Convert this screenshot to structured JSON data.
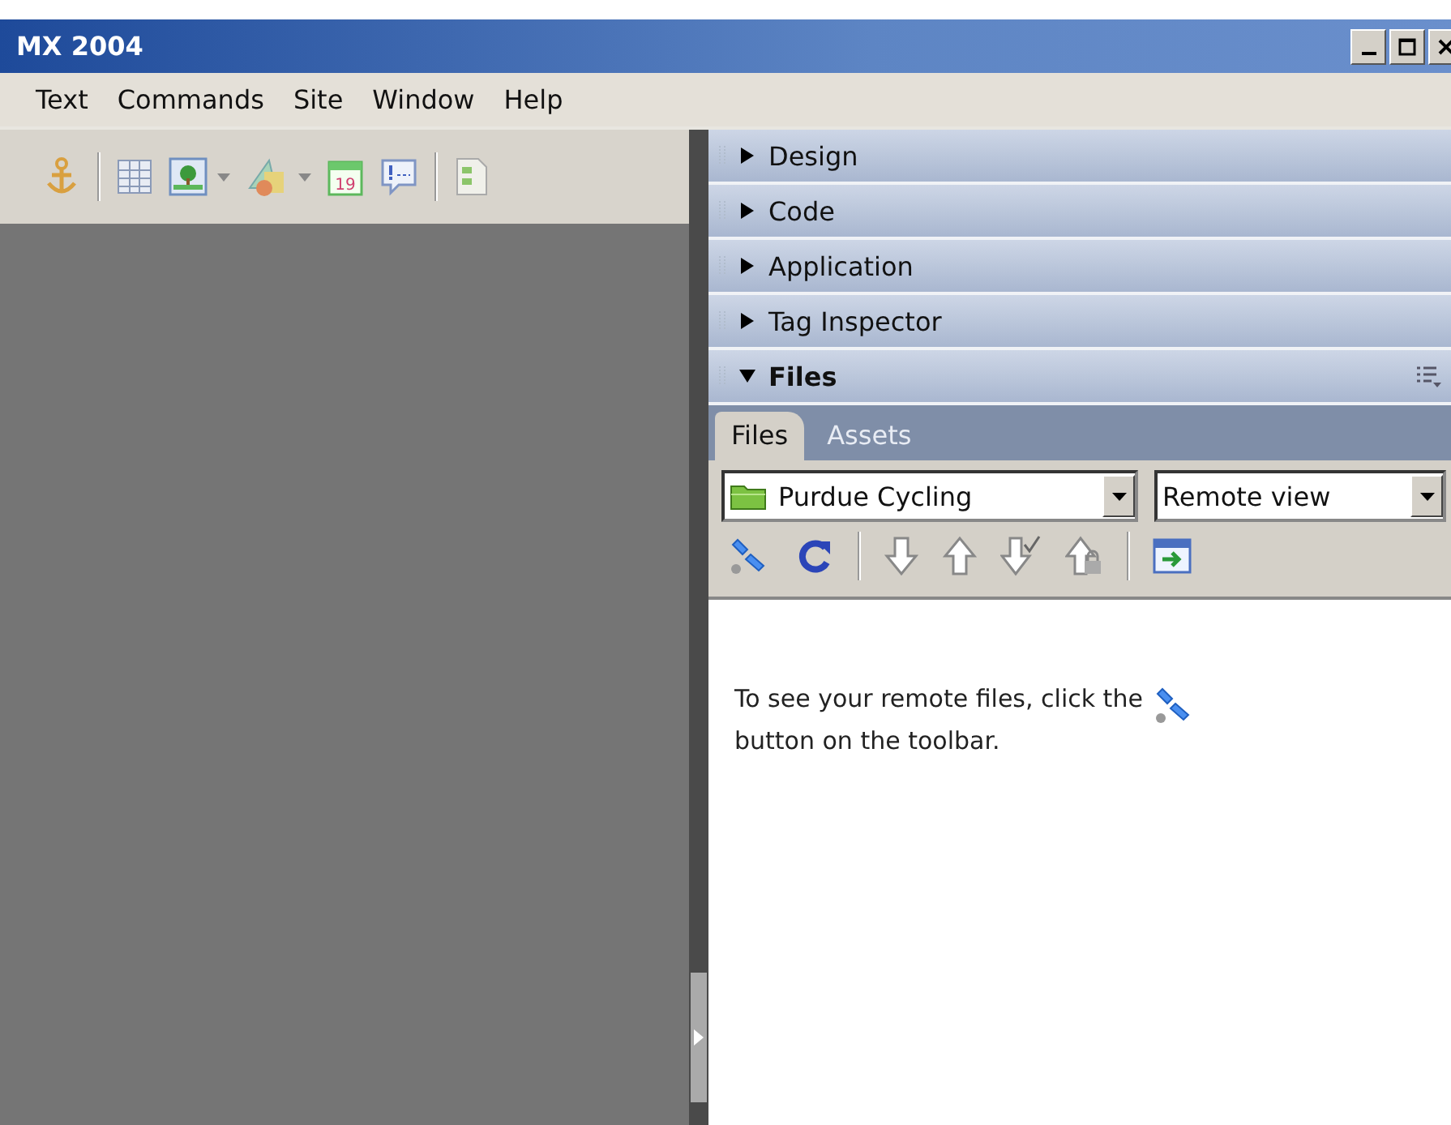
{
  "window": {
    "title": "MX 2004"
  },
  "toolbar": {
    "calendar_day": "19"
  },
  "menu": [
    "Text",
    "Commands",
    "Site",
    "Window",
    "Help"
  ],
  "panels": [
    {
      "label": "Design",
      "expanded": false
    },
    {
      "label": "Code",
      "expanded": false
    },
    {
      "label": "Application",
      "expanded": false
    },
    {
      "label": "Tag Inspector",
      "expanded": false
    },
    {
      "label": "Files",
      "expanded": true
    }
  ],
  "tabs": [
    {
      "label": "Files",
      "selected": true
    },
    {
      "label": "Assets",
      "selected": false
    }
  ],
  "site_dropdown": {
    "value": "Purdue Cycling"
  },
  "view_dropdown": {
    "value": "Remote view"
  },
  "message": {
    "before": "To see your remote files, click the",
    "after": "button on the toolbar."
  }
}
